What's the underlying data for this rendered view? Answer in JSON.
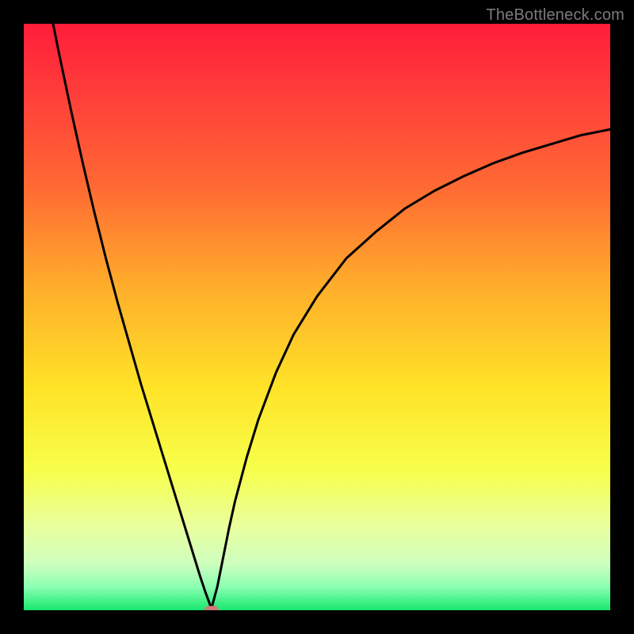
{
  "watermark": {
    "text": "TheBottleneck.com"
  },
  "chart_data": {
    "type": "line",
    "title": "",
    "xlabel": "",
    "ylabel": "",
    "xlim": [
      0,
      100
    ],
    "ylim": [
      0,
      100
    ],
    "grid": false,
    "legend": false,
    "description": "Bottleneck curve on a vertical rainbow gradient (red at top / high bottleneck, green at bottom / low bottleneck). Curve has a cusp minimum near x≈32 at y≈0.",
    "minimum": {
      "x": 32,
      "y": 0
    },
    "gradient_stops": [
      {
        "offset": 0.0,
        "color": "#ff1d3a"
      },
      {
        "offset": 0.12,
        "color": "#ff3e3a"
      },
      {
        "offset": 0.28,
        "color": "#ff6a33"
      },
      {
        "offset": 0.45,
        "color": "#ffae2b"
      },
      {
        "offset": 0.62,
        "color": "#ffe327"
      },
      {
        "offset": 0.76,
        "color": "#f7ff4a"
      },
      {
        "offset": 0.86,
        "color": "#e8ffa0"
      },
      {
        "offset": 0.92,
        "color": "#cfffbe"
      },
      {
        "offset": 0.96,
        "color": "#8cffb2"
      },
      {
        "offset": 1.0,
        "color": "#17e86f"
      }
    ],
    "marker_color": "#cf7a77",
    "curve_left": [
      {
        "x": 5.0,
        "y": 100.0
      },
      {
        "x": 6.0,
        "y": 95.0
      },
      {
        "x": 8.0,
        "y": 85.5
      },
      {
        "x": 10.0,
        "y": 76.5
      },
      {
        "x": 12.0,
        "y": 68.0
      },
      {
        "x": 14.0,
        "y": 60.0
      },
      {
        "x": 16.0,
        "y": 52.5
      },
      {
        "x": 18.0,
        "y": 45.5
      },
      {
        "x": 20.0,
        "y": 38.5
      },
      {
        "x": 22.0,
        "y": 32.0
      },
      {
        "x": 24.0,
        "y": 25.5
      },
      {
        "x": 26.0,
        "y": 19.0
      },
      {
        "x": 28.0,
        "y": 12.5
      },
      {
        "x": 30.0,
        "y": 6.0
      },
      {
        "x": 31.0,
        "y": 3.0
      },
      {
        "x": 32.0,
        "y": 0.3
      }
    ],
    "curve_right": [
      {
        "x": 32.0,
        "y": 0.3
      },
      {
        "x": 33.0,
        "y": 4.0
      },
      {
        "x": 34.0,
        "y": 9.0
      },
      {
        "x": 35.0,
        "y": 14.0
      },
      {
        "x": 36.0,
        "y": 18.5
      },
      {
        "x": 38.0,
        "y": 26.0
      },
      {
        "x": 40.0,
        "y": 32.5
      },
      {
        "x": 43.0,
        "y": 40.5
      },
      {
        "x": 46.0,
        "y": 47.0
      },
      {
        "x": 50.0,
        "y": 53.5
      },
      {
        "x": 55.0,
        "y": 60.0
      },
      {
        "x": 60.0,
        "y": 64.5
      },
      {
        "x": 65.0,
        "y": 68.5
      },
      {
        "x": 70.0,
        "y": 71.5
      },
      {
        "x": 75.0,
        "y": 74.0
      },
      {
        "x": 80.0,
        "y": 76.2
      },
      {
        "x": 85.0,
        "y": 78.0
      },
      {
        "x": 90.0,
        "y": 79.5
      },
      {
        "x": 95.0,
        "y": 81.0
      },
      {
        "x": 100.0,
        "y": 82.0
      }
    ]
  }
}
